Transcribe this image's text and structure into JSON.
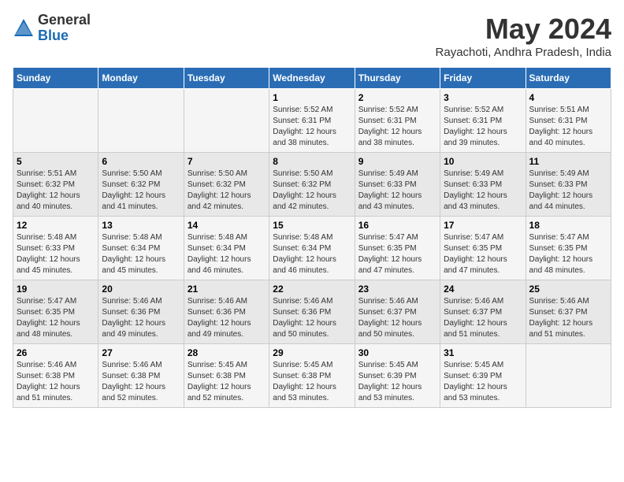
{
  "logo": {
    "general": "General",
    "blue": "Blue"
  },
  "title": {
    "month_year": "May 2024",
    "location": "Rayachoti, Andhra Pradesh, India"
  },
  "days_header": [
    "Sunday",
    "Monday",
    "Tuesday",
    "Wednesday",
    "Thursday",
    "Friday",
    "Saturday"
  ],
  "weeks": [
    [
      {
        "day": "",
        "info": ""
      },
      {
        "day": "",
        "info": ""
      },
      {
        "day": "",
        "info": ""
      },
      {
        "day": "1",
        "sunrise": "Sunrise: 5:52 AM",
        "sunset": "Sunset: 6:31 PM",
        "daylight": "Daylight: 12 hours and 38 minutes."
      },
      {
        "day": "2",
        "sunrise": "Sunrise: 5:52 AM",
        "sunset": "Sunset: 6:31 PM",
        "daylight": "Daylight: 12 hours and 38 minutes."
      },
      {
        "day": "3",
        "sunrise": "Sunrise: 5:52 AM",
        "sunset": "Sunset: 6:31 PM",
        "daylight": "Daylight: 12 hours and 39 minutes."
      },
      {
        "day": "4",
        "sunrise": "Sunrise: 5:51 AM",
        "sunset": "Sunset: 6:31 PM",
        "daylight": "Daylight: 12 hours and 40 minutes."
      }
    ],
    [
      {
        "day": "5",
        "sunrise": "Sunrise: 5:51 AM",
        "sunset": "Sunset: 6:32 PM",
        "daylight": "Daylight: 12 hours and 40 minutes."
      },
      {
        "day": "6",
        "sunrise": "Sunrise: 5:50 AM",
        "sunset": "Sunset: 6:32 PM",
        "daylight": "Daylight: 12 hours and 41 minutes."
      },
      {
        "day": "7",
        "sunrise": "Sunrise: 5:50 AM",
        "sunset": "Sunset: 6:32 PM",
        "daylight": "Daylight: 12 hours and 42 minutes."
      },
      {
        "day": "8",
        "sunrise": "Sunrise: 5:50 AM",
        "sunset": "Sunset: 6:32 PM",
        "daylight": "Daylight: 12 hours and 42 minutes."
      },
      {
        "day": "9",
        "sunrise": "Sunrise: 5:49 AM",
        "sunset": "Sunset: 6:33 PM",
        "daylight": "Daylight: 12 hours and 43 minutes."
      },
      {
        "day": "10",
        "sunrise": "Sunrise: 5:49 AM",
        "sunset": "Sunset: 6:33 PM",
        "daylight": "Daylight: 12 hours and 43 minutes."
      },
      {
        "day": "11",
        "sunrise": "Sunrise: 5:49 AM",
        "sunset": "Sunset: 6:33 PM",
        "daylight": "Daylight: 12 hours and 44 minutes."
      }
    ],
    [
      {
        "day": "12",
        "sunrise": "Sunrise: 5:48 AM",
        "sunset": "Sunset: 6:33 PM",
        "daylight": "Daylight: 12 hours and 45 minutes."
      },
      {
        "day": "13",
        "sunrise": "Sunrise: 5:48 AM",
        "sunset": "Sunset: 6:34 PM",
        "daylight": "Daylight: 12 hours and 45 minutes."
      },
      {
        "day": "14",
        "sunrise": "Sunrise: 5:48 AM",
        "sunset": "Sunset: 6:34 PM",
        "daylight": "Daylight: 12 hours and 46 minutes."
      },
      {
        "day": "15",
        "sunrise": "Sunrise: 5:48 AM",
        "sunset": "Sunset: 6:34 PM",
        "daylight": "Daylight: 12 hours and 46 minutes."
      },
      {
        "day": "16",
        "sunrise": "Sunrise: 5:47 AM",
        "sunset": "Sunset: 6:35 PM",
        "daylight": "Daylight: 12 hours and 47 minutes."
      },
      {
        "day": "17",
        "sunrise": "Sunrise: 5:47 AM",
        "sunset": "Sunset: 6:35 PM",
        "daylight": "Daylight: 12 hours and 47 minutes."
      },
      {
        "day": "18",
        "sunrise": "Sunrise: 5:47 AM",
        "sunset": "Sunset: 6:35 PM",
        "daylight": "Daylight: 12 hours and 48 minutes."
      }
    ],
    [
      {
        "day": "19",
        "sunrise": "Sunrise: 5:47 AM",
        "sunset": "Sunset: 6:35 PM",
        "daylight": "Daylight: 12 hours and 48 minutes."
      },
      {
        "day": "20",
        "sunrise": "Sunrise: 5:46 AM",
        "sunset": "Sunset: 6:36 PM",
        "daylight": "Daylight: 12 hours and 49 minutes."
      },
      {
        "day": "21",
        "sunrise": "Sunrise: 5:46 AM",
        "sunset": "Sunset: 6:36 PM",
        "daylight": "Daylight: 12 hours and 49 minutes."
      },
      {
        "day": "22",
        "sunrise": "Sunrise: 5:46 AM",
        "sunset": "Sunset: 6:36 PM",
        "daylight": "Daylight: 12 hours and 50 minutes."
      },
      {
        "day": "23",
        "sunrise": "Sunrise: 5:46 AM",
        "sunset": "Sunset: 6:37 PM",
        "daylight": "Daylight: 12 hours and 50 minutes."
      },
      {
        "day": "24",
        "sunrise": "Sunrise: 5:46 AM",
        "sunset": "Sunset: 6:37 PM",
        "daylight": "Daylight: 12 hours and 51 minutes."
      },
      {
        "day": "25",
        "sunrise": "Sunrise: 5:46 AM",
        "sunset": "Sunset: 6:37 PM",
        "daylight": "Daylight: 12 hours and 51 minutes."
      }
    ],
    [
      {
        "day": "26",
        "sunrise": "Sunrise: 5:46 AM",
        "sunset": "Sunset: 6:38 PM",
        "daylight": "Daylight: 12 hours and 51 minutes."
      },
      {
        "day": "27",
        "sunrise": "Sunrise: 5:46 AM",
        "sunset": "Sunset: 6:38 PM",
        "daylight": "Daylight: 12 hours and 52 minutes."
      },
      {
        "day": "28",
        "sunrise": "Sunrise: 5:45 AM",
        "sunset": "Sunset: 6:38 PM",
        "daylight": "Daylight: 12 hours and 52 minutes."
      },
      {
        "day": "29",
        "sunrise": "Sunrise: 5:45 AM",
        "sunset": "Sunset: 6:38 PM",
        "daylight": "Daylight: 12 hours and 53 minutes."
      },
      {
        "day": "30",
        "sunrise": "Sunrise: 5:45 AM",
        "sunset": "Sunset: 6:39 PM",
        "daylight": "Daylight: 12 hours and 53 minutes."
      },
      {
        "day": "31",
        "sunrise": "Sunrise: 5:45 AM",
        "sunset": "Sunset: 6:39 PM",
        "daylight": "Daylight: 12 hours and 53 minutes."
      },
      {
        "day": "",
        "info": ""
      }
    ]
  ]
}
